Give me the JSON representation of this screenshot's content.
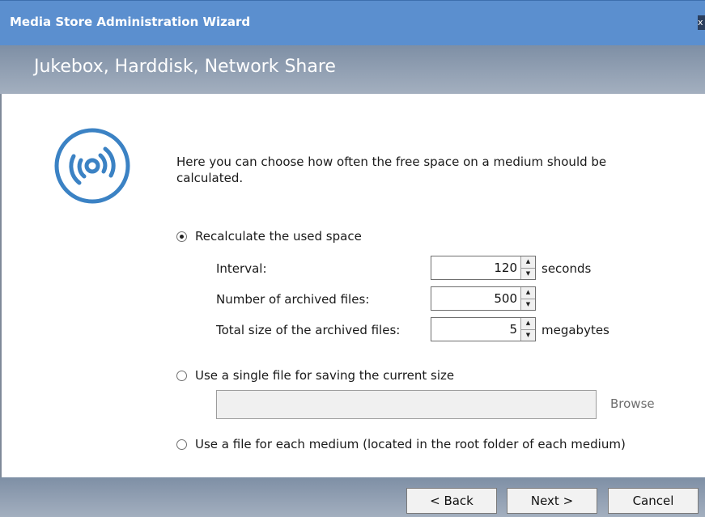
{
  "window": {
    "title": "Media Store Administration Wizard",
    "close_glyph": "x"
  },
  "header": {
    "subtitle": "Jukebox, Harddisk, Network Share"
  },
  "icon": "media-disc-icon",
  "description": "Here you can choose how often the free space on a medium should be calculated.",
  "options": {
    "recalculate": {
      "label": "Recalculate the used space",
      "selected": true
    },
    "single_file": {
      "label": "Use a single file for saving the current size",
      "selected": false
    },
    "per_medium": {
      "label": "Use a file for each medium (located in the root folder of each medium)",
      "selected": false
    }
  },
  "settings": {
    "interval": {
      "label": "Interval:",
      "value": "120",
      "unit": "seconds"
    },
    "num_files": {
      "label": "Number of archived files:",
      "value": "500",
      "unit": ""
    },
    "total_size": {
      "label": "Total size of the archived files:",
      "value": "5",
      "unit": "megabytes"
    }
  },
  "file_path": {
    "value": "",
    "browse_label": "Browse"
  },
  "buttons": {
    "back": "< Back",
    "next": "Next >",
    "cancel": "Cancel"
  },
  "colors": {
    "titlebar": "#5b8fcf",
    "header": "#8f9db0",
    "disc": "#3b82c4"
  }
}
